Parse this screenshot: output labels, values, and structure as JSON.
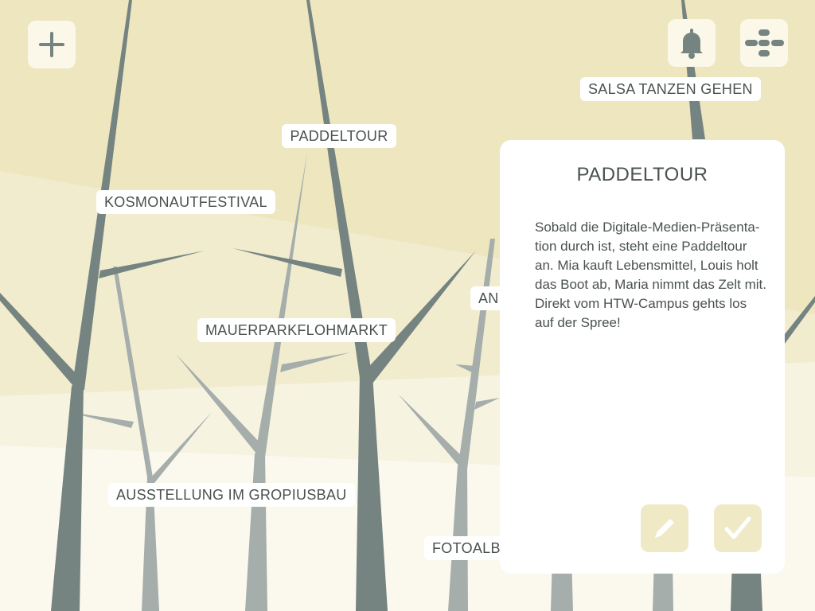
{
  "toolbar": {
    "add_icon": "plus-icon",
    "notification_icon": "bell-icon",
    "overview_icon": "tree-structure-icon"
  },
  "activity_tags": [
    {
      "label": "SALSA TANZEN GEHEN"
    },
    {
      "label": "PADDELTOUR"
    },
    {
      "label": "KOSMONAUTFESTIVAL"
    },
    {
      "label": "MAUERPARKFLOHMARKT"
    },
    {
      "label": "AN"
    },
    {
      "label": "AUSSTELLUNG IM GROPIUSBAU"
    },
    {
      "label": "FOTOALBE"
    }
  ],
  "detail_card": {
    "title": "PADDELTOUR",
    "description": "Sobald die Digitale-Medien-Präsenta-tion durch ist, steht eine Paddeltour an. Mia kauft Lebensmittel, Louis holt das Boot ab, Maria nimmt das Zelt mit. Direkt vom HTW-Campus gehts los auf der Spree!",
    "edit_icon": "pencil-icon",
    "confirm_icon": "checkmark-icon"
  },
  "colors": {
    "sky": "#ede6bf",
    "ground": "#fbf8ee",
    "trunk_dark": "#758481",
    "trunk_light": "#a5aeab",
    "button_bg": "#fbf8ea",
    "card_button_bg": "#efe9c6"
  }
}
